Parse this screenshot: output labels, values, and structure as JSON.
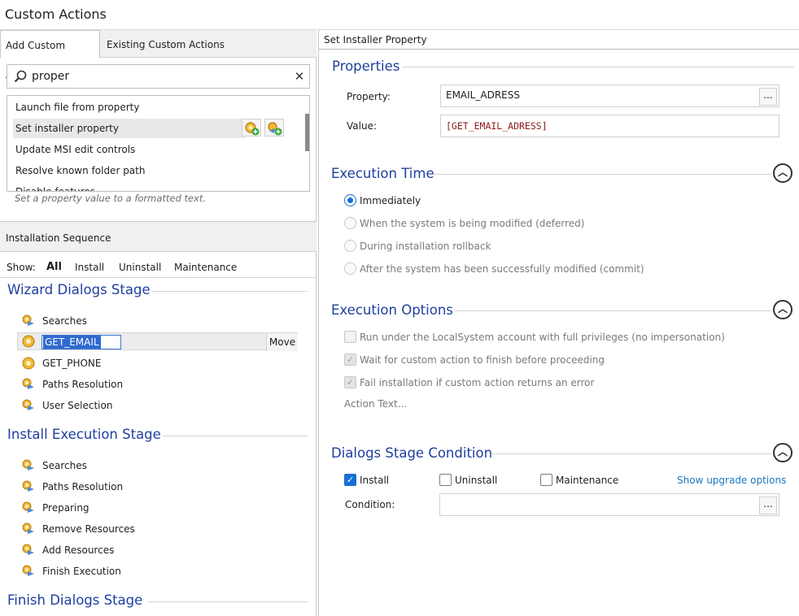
{
  "page_title": "Custom Actions",
  "tabs": [
    {
      "label": "Add Custom Action",
      "active": true
    },
    {
      "label": "Existing Custom Actions",
      "active": false
    }
  ],
  "search": {
    "value": "proper",
    "clear_icon": "close-icon"
  },
  "action_list": {
    "items": [
      "Launch file from property",
      "Set installer property",
      "Update MSI edit controls",
      "Resolve known folder path",
      "Disable features"
    ],
    "selected_index": 1,
    "description": "Set a property value to a formatted text."
  },
  "installation_sequence": {
    "title": "Installation Sequence",
    "show_label": "Show:",
    "filters": [
      "All",
      "Install",
      "Uninstall",
      "Maintenance"
    ],
    "active_filter": "All",
    "stages": {
      "wizard": {
        "title": "Wizard Dialogs Stage",
        "items": [
          "Searches",
          "GET_EMAIL",
          "GET_PHONE",
          "Paths Resolution",
          "User Selection"
        ]
      },
      "execution": {
        "title": "Install Execution Stage",
        "items": [
          "Searches",
          "Paths Resolution",
          "Preparing",
          "Remove Resources",
          "Add Resources",
          "Finish Execution"
        ]
      },
      "finish": {
        "title": "Finish Dialogs Stage"
      }
    },
    "move_label": "Move"
  },
  "right_panel": {
    "tab_title": "Set Installer Property",
    "properties": {
      "heading": "Properties",
      "property_label": "Property:",
      "property_value": "EMAIL_ADRESS",
      "value_label": "Value:",
      "value_value": "[GET_EMAIL_ADRESS]",
      "browse_label": "..."
    },
    "execution_time": {
      "heading": "Execution Time",
      "options": [
        "Immediately",
        "When the system is being modified (deferred)",
        "During installation rollback",
        "After the system has been successfully modified (commit)"
      ],
      "selected": 0
    },
    "execution_options": {
      "heading": "Execution Options",
      "options": [
        "Run under the LocalSystem account with full privileges (no impersonation)",
        "Wait for custom action to finish before proceeding",
        "Fail installation if custom action returns an error"
      ],
      "checked": [
        false,
        true,
        true
      ],
      "action_text": "Action Text..."
    },
    "dialogs_condition": {
      "heading": "Dialogs Stage Condition",
      "install": "Install",
      "uninstall": "Uninstall",
      "maintenance": "Maintenance",
      "upgrade_link": "Show upgrade options",
      "condition_label": "Condition:",
      "condition_value": "",
      "browse_label": "..."
    }
  },
  "colors": {
    "accent": "#1f3f9f",
    "link": "#1a78c2",
    "selection": "#2f6ad0"
  }
}
